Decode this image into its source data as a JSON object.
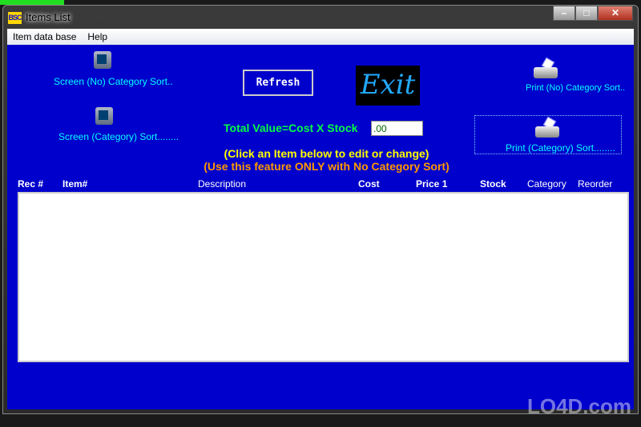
{
  "window": {
    "title": "Items List",
    "app_icon": "BSC",
    "minimize": "–",
    "maximize": "□",
    "close": "✕"
  },
  "menu": [
    "Item data base",
    "Help"
  ],
  "buttons": {
    "screen_no_cat": "Screen (No) Category Sort..",
    "screen_cat": "Screen (Category) Sort........",
    "refresh": "Refresh",
    "exit": "Exit",
    "print_no_cat": "Print (No) Category Sort..",
    "print_cat": "Print (Category) Sort........"
  },
  "total": {
    "label": "Total Value=Cost X Stock",
    "value": ".00"
  },
  "hints": {
    "line1": "(Click an Item below to edit or change)",
    "line2": "(Use this feature ONLY with No Category Sort)"
  },
  "columns": [
    "Rec #",
    "Item#",
    "Description",
    "Cost",
    "Price 1",
    "Stock",
    "Category",
    "Reorder"
  ],
  "watermark": "LO4D.com"
}
